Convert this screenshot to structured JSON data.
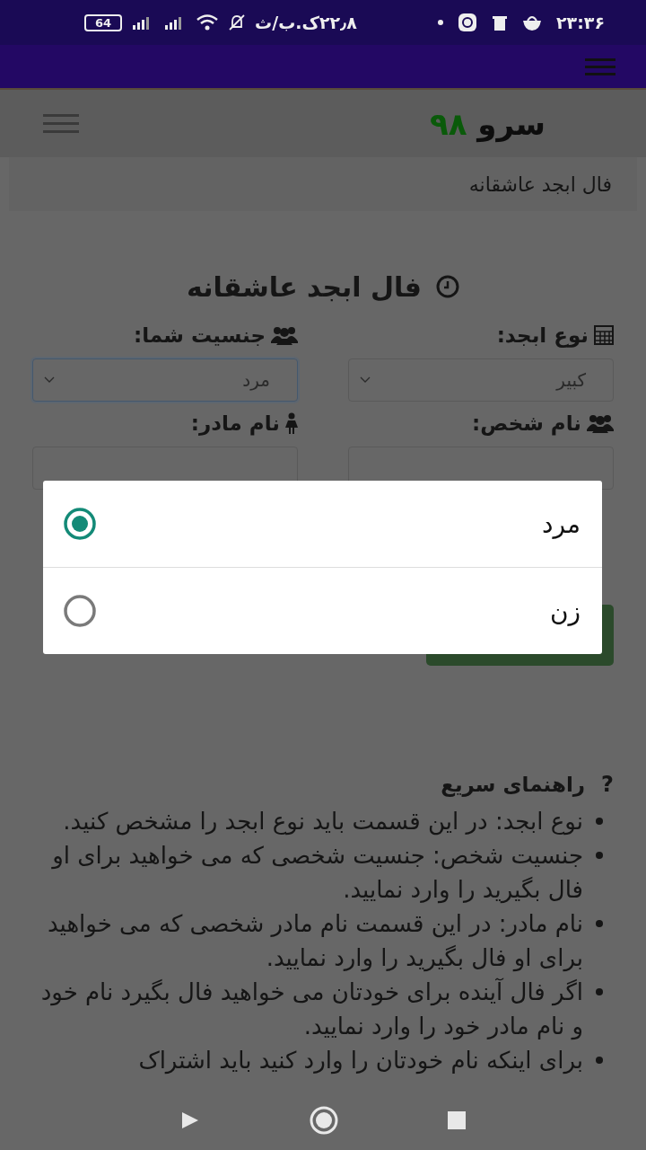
{
  "status_bar": {
    "time": "۲۳:۳۶",
    "speed": "۲۲٫۸ک.ب/ث",
    "battery": "64"
  },
  "header": {
    "logo_text": "سرو",
    "logo_number": "۹۸"
  },
  "breadcrumb": "فال ابجد عاشقانه",
  "title": "فال ابجد عاشقانه",
  "form": {
    "fields": [
      {
        "kind": "select",
        "label": "نوع ابجد:",
        "value": "کبیر",
        "focused": false
      },
      {
        "kind": "select",
        "label": "جنسیت شما:",
        "value": "مرد",
        "focused": true
      },
      {
        "kind": "input",
        "label": "نام شخص:",
        "focused": false
      },
      {
        "kind": "input",
        "label": "نام مادر:",
        "focused": false
      }
    ]
  },
  "help": {
    "title": "راهنمای سریع",
    "icon": "?",
    "items": [
      "نوع ابجد: در این قسمت باید نوع ابجد را مشخص کنید.",
      "جنسیت شخص: جنسیت شخصی که می خواهید برای او فال بگیرید را وارد نمایید.",
      "نام مادر: در این قسمت نام مادر شخصی که می خواهید برای او فال بگیرید را وارد نمایید.",
      "اگر فال آینده برای خودتان می خواهید فال بگیرد نام خود و نام مادر خود را وارد نمایید.",
      "برای اینکه نام خودتان را وارد کنید باید اشتراک"
    ]
  },
  "dialog": {
    "options": [
      {
        "label": "مرد",
        "selected": true
      },
      {
        "label": "زن",
        "selected": false
      }
    ]
  }
}
